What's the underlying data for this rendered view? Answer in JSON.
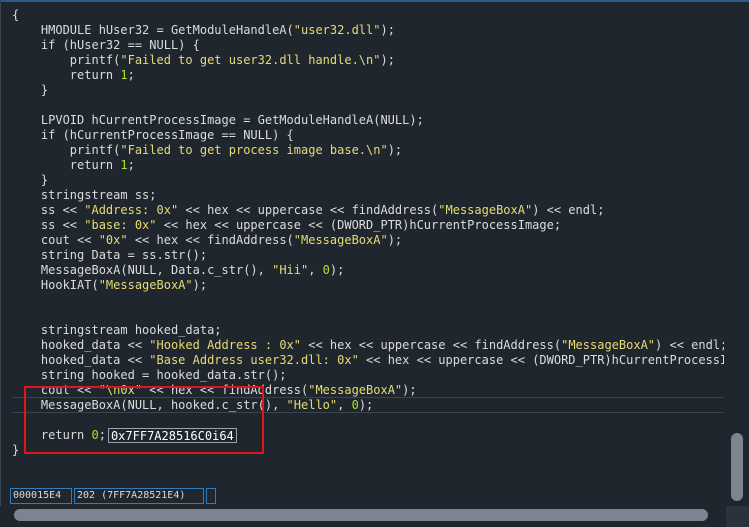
{
  "editor": {
    "lines": [
      [
        {
          "t": "{"
        }
      ],
      [
        {
          "t": "    HMODULE hUser32 = GetModuleHandleA("
        },
        {
          "t": "\"user32.dll\"",
          "c": "str"
        },
        {
          "t": ");"
        }
      ],
      [
        {
          "t": "    if (hUser32 == NULL) {"
        }
      ],
      [
        {
          "t": "        printf("
        },
        {
          "t": "\"Failed to get user32.dll handle.\\n\"",
          "c": "str"
        },
        {
          "t": ");"
        }
      ],
      [
        {
          "t": "        return "
        },
        {
          "t": "1",
          "c": "num"
        },
        {
          "t": ";"
        }
      ],
      [
        {
          "t": "    }"
        }
      ],
      [
        {
          "t": ""
        }
      ],
      [
        {
          "t": "    LPVOID hCurrentProcessImage = GetModuleHandleA(NULL);"
        }
      ],
      [
        {
          "t": "    if (hCurrentProcessImage == NULL) {"
        }
      ],
      [
        {
          "t": "        printf("
        },
        {
          "t": "\"Failed to get process image base.\\n\"",
          "c": "str"
        },
        {
          "t": ");"
        }
      ],
      [
        {
          "t": "        return "
        },
        {
          "t": "1",
          "c": "num"
        },
        {
          "t": ";"
        }
      ],
      [
        {
          "t": "    }"
        }
      ],
      [
        {
          "t": "    stringstream ss;"
        }
      ],
      [
        {
          "t": "    ss << "
        },
        {
          "t": "\"Address: 0x\"",
          "c": "str"
        },
        {
          "t": " << hex << uppercase << findAddress("
        },
        {
          "t": "\"MessageBoxA\"",
          "c": "str"
        },
        {
          "t": ") << endl;"
        }
      ],
      [
        {
          "t": "    ss << "
        },
        {
          "t": "\"base: 0x\"",
          "c": "str"
        },
        {
          "t": " << hex << uppercase << (DWORD_PTR)hCurrentProcessImage;"
        }
      ],
      [
        {
          "t": "    cout << "
        },
        {
          "t": "\"0x\"",
          "c": "str"
        },
        {
          "t": " << hex << findAddress("
        },
        {
          "t": "\"MessageBoxA\"",
          "c": "str"
        },
        {
          "t": ");"
        }
      ],
      [
        {
          "t": "    string Data = ss.str();"
        }
      ],
      [
        {
          "t": "    MessageBoxA(NULL, Data.c_str(), "
        },
        {
          "t": "\"Hii\"",
          "c": "str"
        },
        {
          "t": ", "
        },
        {
          "t": "0",
          "c": "num"
        },
        {
          "t": ");"
        }
      ],
      [
        {
          "t": "    HookIAT("
        },
        {
          "t": "\"MessageBoxA\"",
          "c": "str"
        },
        {
          "t": ");"
        }
      ],
      [
        {
          "t": ""
        }
      ],
      [
        {
          "t": ""
        }
      ],
      [
        {
          "t": "    stringstream hooked_data;"
        }
      ],
      [
        {
          "t": "    hooked_data << "
        },
        {
          "t": "\"Hooked Address : 0x\"",
          "c": "str"
        },
        {
          "t": " << hex << uppercase << findAddress("
        },
        {
          "t": "\"MessageBoxA\"",
          "c": "str"
        },
        {
          "t": ") << endl;"
        }
      ],
      [
        {
          "t": "    hooked_data << "
        },
        {
          "t": "\"Base Address user32.dll: 0x\"",
          "c": "str"
        },
        {
          "t": " << hex << uppercase << (DWORD_PTR)hCurrentProcessImag"
        }
      ],
      [
        {
          "t": "    string hooked = hooked_data.str();"
        }
      ],
      [
        {
          "t": "    cout << "
        },
        {
          "t": "\"\\n0x\"",
          "c": "str"
        },
        {
          "t": " << hex << findAddress("
        },
        {
          "t": "\"MessageBoxA\"",
          "c": "str"
        },
        {
          "t": ");"
        }
      ],
      [
        {
          "t": "    MessageBoxA(NULL, hooked.c_str(), "
        },
        {
          "t": "\"Hello\"",
          "c": "str"
        },
        {
          "t": ", "
        },
        {
          "t": "0",
          "c": "num"
        },
        {
          "t": ");"
        }
      ],
      [
        {
          "t": ""
        }
      ],
      [
        {
          "t": "    return "
        },
        {
          "t": "0",
          "c": "num"
        },
        {
          "t": ";"
        }
      ],
      [
        {
          "t": "}"
        }
      ]
    ],
    "current_line_index": 26,
    "return_line_index": 28,
    "return_value_tooltip": "0x7FF7A28516C0i64"
  },
  "status_bar": {
    "offset": "000015E4",
    "position": "202 (7FF7A28521E4)",
    "extra": ""
  }
}
